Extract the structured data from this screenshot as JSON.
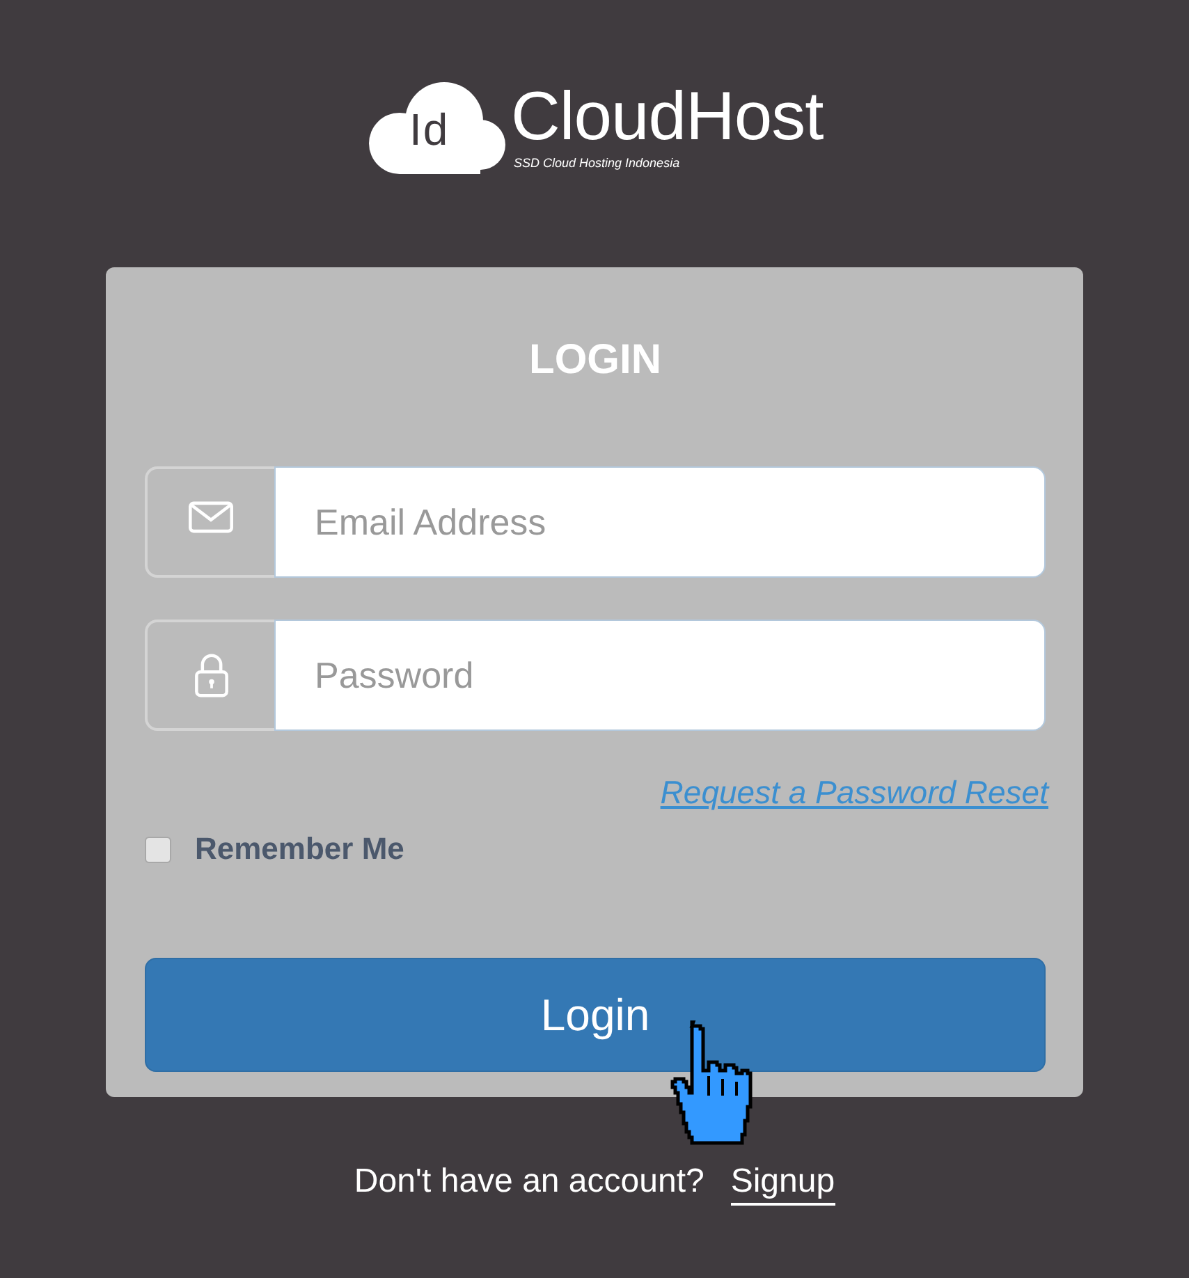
{
  "logo": {
    "badge": "Id",
    "name": "CloudHost",
    "tagline": "SSD Cloud Hosting Indonesia"
  },
  "form": {
    "title": "LOGIN",
    "fields": [
      {
        "kind": "email",
        "placeholder": "Email Address"
      },
      {
        "kind": "password",
        "placeholder": "Password"
      }
    ],
    "reset_link": "Request a Password Reset",
    "remember": {
      "label": "Remember Me",
      "checked": false
    },
    "submit": "Login"
  },
  "footer": {
    "prompt": "Don't have an account?",
    "link": "Signup"
  }
}
